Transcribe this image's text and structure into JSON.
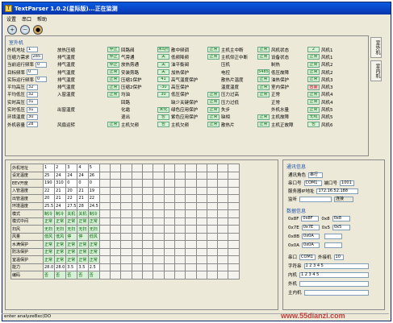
{
  "title": "TextParser 1.0.2(星际版)...正在监测",
  "menu": [
    "设置",
    "串口",
    "帮助"
  ],
  "toolbar_icons": [
    "zoom-in-icon",
    "zoom-out-icon",
    "record-icon"
  ],
  "panel_title": "室外机",
  "params": {
    "c1": [
      [
        "外机地址",
        "1"
      ],
      [
        "压缩力需求",
        "285"
      ],
      [
        "当前运行频率",
        "0"
      ],
      [
        "目标频率",
        "0"
      ],
      [
        "实际运行频率",
        "0"
      ],
      [
        "平均高压",
        "32"
      ],
      [
        "平均低压",
        "32"
      ],
      [
        "实时高压",
        "31"
      ],
      [
        "实时低压",
        "31"
      ],
      [
        "环境温度",
        "30"
      ],
      [
        "外机容量",
        "28"
      ]
    ],
    "c2": [
      "放热压缩",
      "排气温度",
      "排气温度",
      "排气温度",
      "排气温度",
      "排气温度",
      "入窗温度",
      "",
      "出窗温度",
      "",
      "风扇运转"
    ],
    "c3": [
      [
        "停止",
        "回路阀"
      ],
      [
        "停止",
        "气旁通"
      ],
      [
        "停止",
        "放热旁通"
      ],
      [
        "正常",
        "安装旁路"
      ],
      [
        "正常",
        "压缩1保护"
      ],
      [
        "正常",
        "压缩2保护"
      ],
      [
        "正常",
        "均油"
      ],
      [
        "",
        "回路"
      ],
      [
        "",
        "化霜"
      ],
      [
        "",
        "退出"
      ],
      [
        "正常",
        "主机欠频"
      ]
    ],
    "c4": [
      [
        "未动作",
        "散中频调"
      ],
      [
        "关",
        "低频降频"
      ],
      [
        "关",
        "油平衡阀"
      ],
      [
        "关",
        "加热保护"
      ],
      [
        "41",
        "高气温度保护"
      ],
      [
        "-30",
        "高压保护"
      ],
      [
        "30",
        "低压保护"
      ],
      [
        "",
        "缺少关键保护"
      ],
      [
        "未化",
        "绿色应用保护"
      ],
      [
        "否",
        "紫色应用保护"
      ],
      [
        "否",
        "主机欠频"
      ]
    ],
    "c5": [
      [
        "正常",
        "主机主中断"
      ],
      [
        "正常",
        "主机仰正中断"
      ],
      [
        "",
        "压机"
      ],
      [
        "",
        "电控"
      ],
      [
        "",
        "散热片温度"
      ],
      [
        "",
        "温度温度"
      ],
      [
        "正常",
        "压力过高"
      ],
      [
        "正常",
        "压力过低"
      ],
      [
        "正常",
        "失步"
      ],
      [
        "正常",
        "缺相"
      ],
      [
        "正常",
        "散热片"
      ]
    ],
    "c6": [
      [
        "正常",
        "风机状态"
      ],
      [
        "正常",
        "设备状态"
      ],
      [
        "",
        "制热"
      ],
      [
        "5485",
        "低压故障"
      ],
      [
        "正常",
        "油热保护"
      ],
      [
        "正常",
        "室内保护"
      ],
      [
        "正常",
        "正常"
      ],
      [
        "",
        "正常"
      ],
      [
        "",
        "外机水量"
      ],
      [
        "正常",
        "主机故障"
      ],
      [
        "正常",
        "主机正故障"
      ]
    ],
    "c7": [
      [
        "2",
        "风机1"
      ],
      [
        "正常",
        "风机1"
      ],
      [
        "正常",
        "风机2"
      ],
      [
        "正常",
        "风机2"
      ],
      [
        "正常",
        "风机3"
      ],
      [
        "告警",
        "风机3"
      ],
      [
        "正常",
        "风机4"
      ],
      [
        "正常",
        "风机4"
      ],
      [
        "正常",
        "风机5"
      ],
      [
        "无线",
        "风机5"
      ],
      [
        "否",
        "风机6"
      ]
    ]
  },
  "sidetabs": [
    "室外机",
    "室内机"
  ],
  "grid": {
    "rows": [
      {
        "h": "外机地址",
        "v": [
          "1",
          "2",
          "3",
          "4",
          "5"
        ],
        "type": "w"
      },
      {
        "h": "设定温度",
        "v": [
          "25",
          "24",
          "24",
          "24",
          "26"
        ],
        "type": "w"
      },
      {
        "h": "EEV开度",
        "v": [
          "190",
          "310",
          "0",
          "0",
          "0"
        ],
        "type": "w"
      },
      {
        "h": "入管温度",
        "v": [
          "22",
          "21",
          "20",
          "21",
          "19"
        ],
        "type": "w"
      },
      {
        "h": "出管温度",
        "v": [
          "20",
          "21",
          "22",
          "21",
          "22"
        ],
        "type": "w"
      },
      {
        "h": "环境温度",
        "v": [
          "25.5",
          "24",
          "27.5",
          "28",
          "24.5"
        ],
        "type": "w"
      },
      {
        "h": "模式",
        "v": [
          "制冷",
          "制冷",
          "关机",
          "关机",
          "制冷"
        ],
        "type": "g"
      },
      {
        "h": "模式中间",
        "v": [
          "正常",
          "正常",
          "正常",
          "正常",
          "正常"
        ],
        "type": "g"
      },
      {
        "h": "扫风",
        "v": [
          "无扫",
          "无扫",
          "无扫",
          "无扫",
          "无扫"
        ],
        "type": "g"
      },
      {
        "h": "风量",
        "v": [
          "低风",
          "低风",
          "停",
          "停",
          "低风"
        ],
        "type": "g"
      },
      {
        "h": "水满保护",
        "v": [
          "正常",
          "正常",
          "正常",
          "正常",
          "正常"
        ],
        "type": "g"
      },
      {
        "h": "防冻保护",
        "v": [
          "正常",
          "正常",
          "正常",
          "正常",
          "正常"
        ],
        "type": "g"
      },
      {
        "h": "室温保护",
        "v": [
          "正常",
          "正常",
          "正常",
          "正常",
          "正常"
        ],
        "type": "g"
      },
      {
        "h": "能力",
        "v": [
          "28.0",
          "28.0",
          "3.5",
          "3.5",
          "2.5"
        ],
        "type": "w"
      },
      {
        "h": "编码",
        "v": [
          "否",
          "否",
          "否",
          "否",
          "否"
        ],
        "type": "g"
      }
    ],
    "extra_cols": 13
  },
  "right": {
    "comm_title": "通讯信息",
    "comm_role_label": "通讯角色",
    "comm_role": "串行",
    "port_label": "串口号",
    "port": "COM1",
    "port_no_label": "端口号",
    "port_no": "1001",
    "server_label": "服务器IP地址",
    "server": "172.16.52.188",
    "status_label": "监听",
    "status_btn": "连接",
    "data_title": "数据信息",
    "regs": [
      [
        "0x8F",
        "0x8F",
        "0x8",
        "0x8"
      ],
      [
        "0x7E",
        "0x7E",
        "0x5",
        "0x5"
      ],
      [
        "0x8B",
        "0x0A",
        "",
        ""
      ],
      [
        "0x0A",
        "0x0A",
        "",
        ""
      ]
    ],
    "serial_label": "串口",
    "serial": "COM1",
    "baud_label": "外接机",
    "baud": "10",
    "bytes_label": "字符串",
    "bytes": "1 2 3 4 5",
    "indoor_label": "内机",
    "indoor": "1 2 3 4 5",
    "outdoor_label": "外机",
    "outdoor": "",
    "main_label": "主内机",
    "main": ""
  },
  "status": "enter analyze8xc(DO",
  "watermark": "www.55dianzi.com"
}
